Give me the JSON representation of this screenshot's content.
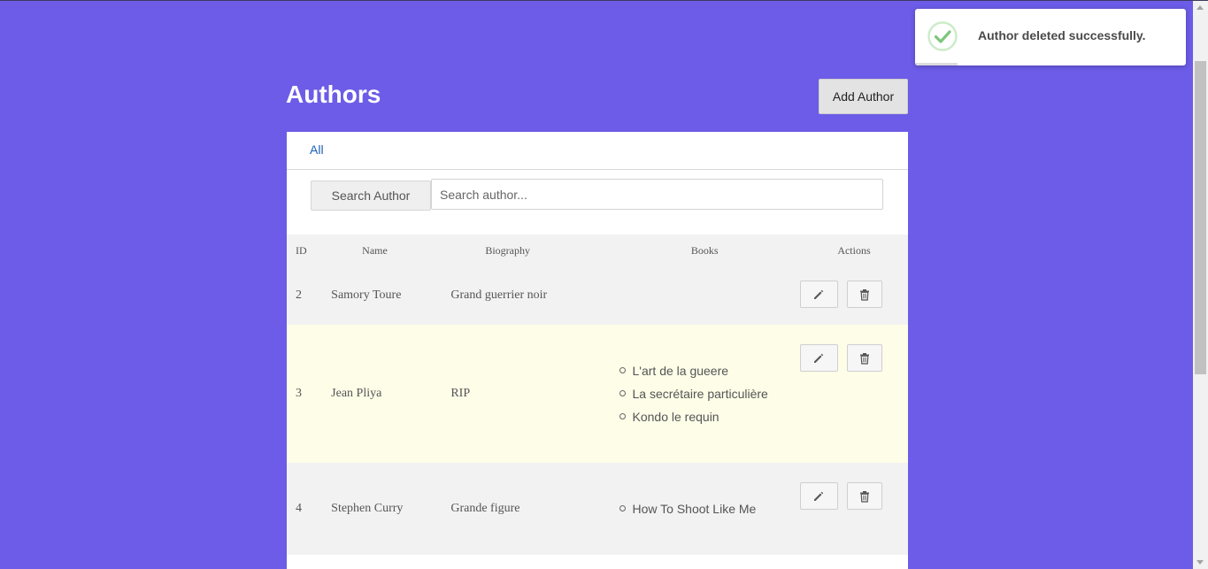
{
  "header": {
    "title": "Authors",
    "add_button": "Add Author"
  },
  "filter_tabs": [
    {
      "label": "All"
    }
  ],
  "search": {
    "button_label": "Search Author",
    "placeholder": "Search author...",
    "value": ""
  },
  "table": {
    "columns": [
      "ID",
      "Name",
      "Biography",
      "Books",
      "Actions"
    ],
    "rows": [
      {
        "id": "2",
        "name": "Samory Toure",
        "biography": "Grand guerrier noir",
        "books": []
      },
      {
        "id": "3",
        "name": "Jean Pliya",
        "biography": "RIP",
        "books": [
          "L'art de la gueere",
          "La secrétaire particulière",
          "Kondo le requin"
        ]
      },
      {
        "id": "4",
        "name": "Stephen Curry",
        "biography": "Grande figure",
        "books": [
          "How To Shoot Like Me"
        ]
      }
    ]
  },
  "toast": {
    "message": "Author deleted successfully.",
    "icon": "check-circle-icon",
    "status_color": "#7bc67b"
  },
  "colors": {
    "background": "#6c5ce7",
    "row_alt": "#f2f2f2",
    "row_highlight": "#fdfde8",
    "link": "#1a5fb4"
  }
}
